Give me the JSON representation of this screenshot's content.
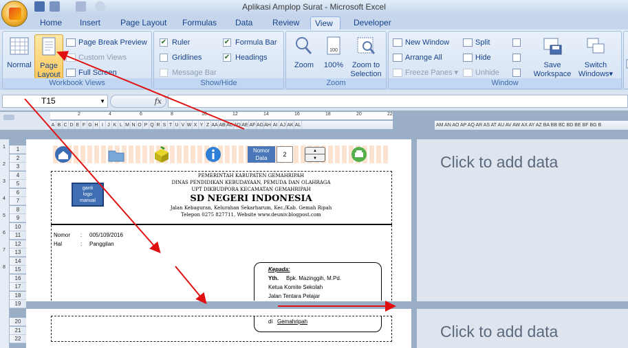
{
  "window": {
    "title": "Aplikasi Amplop Surat - Microsoft Excel"
  },
  "tabs": [
    "Home",
    "Insert",
    "Page Layout",
    "Formulas",
    "Data",
    "Review",
    "View",
    "Developer"
  ],
  "active_tab": "View",
  "ribbon": {
    "workbook_views": {
      "label": "Workbook Views",
      "normal": "Normal",
      "page_layout_1": "Page",
      "page_layout_2": "Layout",
      "page_break_preview": "Page Break Preview",
      "custom_views": "Custom Views",
      "full_screen": "Full Screen"
    },
    "show_hide": {
      "label": "Show/Hide",
      "ruler": "Ruler",
      "gridlines": "Gridlines",
      "message_bar": "Message Bar",
      "formula_bar": "Formula Bar",
      "headings": "Headings"
    },
    "zoom": {
      "label": "Zoom",
      "zoom": "Zoom",
      "pct100": "100%",
      "zoom_sel_1": "Zoom to",
      "zoom_sel_2": "Selection"
    },
    "window": {
      "label": "Window",
      "new_window": "New Window",
      "arrange_all": "Arrange All",
      "freeze_panes": "Freeze Panes",
      "split": "Split",
      "hide": "Hide",
      "unhide": "Unhide",
      "save_ws_1": "Save",
      "save_ws_2": "Workspace",
      "switch_1": "Switch",
      "switch_2": "Windows"
    }
  },
  "formula_bar": {
    "name_box": "T15",
    "fx": "fx",
    "value": ""
  },
  "ruler_numbers": [
    "2",
    "4",
    "6",
    "8",
    "10",
    "12",
    "14",
    "16",
    "18",
    "20",
    "22"
  ],
  "columns_left": [
    "A",
    "B",
    "C",
    "D",
    "E",
    "F",
    "G",
    "H",
    "I",
    "J",
    "K",
    "L",
    "M",
    "N",
    "O",
    "P",
    "Q",
    "R",
    "S",
    "T",
    "U",
    "V",
    "W",
    "X",
    "Y",
    "Z",
    "AA",
    "AB",
    "AC",
    "AD",
    "AE",
    "AF",
    "AG",
    "AH",
    "AI",
    "AJ",
    "AK",
    "AL"
  ],
  "columns_right": "AM AN AO AP AQ AR AS AT AU AV AW AX AY AZ BA BB BC BD BE BF BG B",
  "rows": [
    "1",
    "2",
    "3",
    "4",
    "5",
    "6",
    "7",
    "8",
    "9",
    "10",
    "11",
    "12",
    "13",
    "14",
    "15",
    "16",
    "17",
    "18",
    "19",
    "20",
    "21",
    "22"
  ],
  "side_ruler": [
    "1",
    "2",
    "3",
    "4",
    "5",
    "6",
    "7",
    "8"
  ],
  "pages": {
    "add_data": "Click to add data"
  },
  "toolbar": {
    "nomor_data_1": "Nomor",
    "nomor_data_2": "Data",
    "nomor_value": "2"
  },
  "letter": {
    "logo_text_1": "ganti",
    "logo_text_2": "logo",
    "logo_text_3": "manual",
    "line1": "PEMERINTAH KABUPATEN GEMAHRIPAH",
    "line2": "DINAS PENDIDIKAN KEBUDAYAAN, PEMUDA DAN OLAHRAGA",
    "line3": "UPT DIKBUDPORA KECAMATAN GEMAHRIPAH",
    "school": "SD NEGERI INDONESIA",
    "address": "Jalan Kebaguran, Kelurahan Sekarharum, Kec./Kab. Gemah Ripah",
    "phone": "Telepon 0275 827711, Website www.deuniv.blogpost.com",
    "nomor_label": "Nomor",
    "nomor_sep": ":",
    "nomor_value": "005/109/2016",
    "hal_label": "Hal",
    "hal_sep": ":",
    "hal_value": "Panggilan",
    "kepada": "Kepada:",
    "yth": "Yth.",
    "recipient": "Bpk. Mazinggih, M.Pd.",
    "role1": "Ketua Komite Sekolah",
    "role2": "Jalan Tentara Pelajar",
    "di": "di",
    "place": "Gemahripah"
  },
  "colors": {
    "arrow": "#e01010",
    "accent": "#15428b"
  }
}
